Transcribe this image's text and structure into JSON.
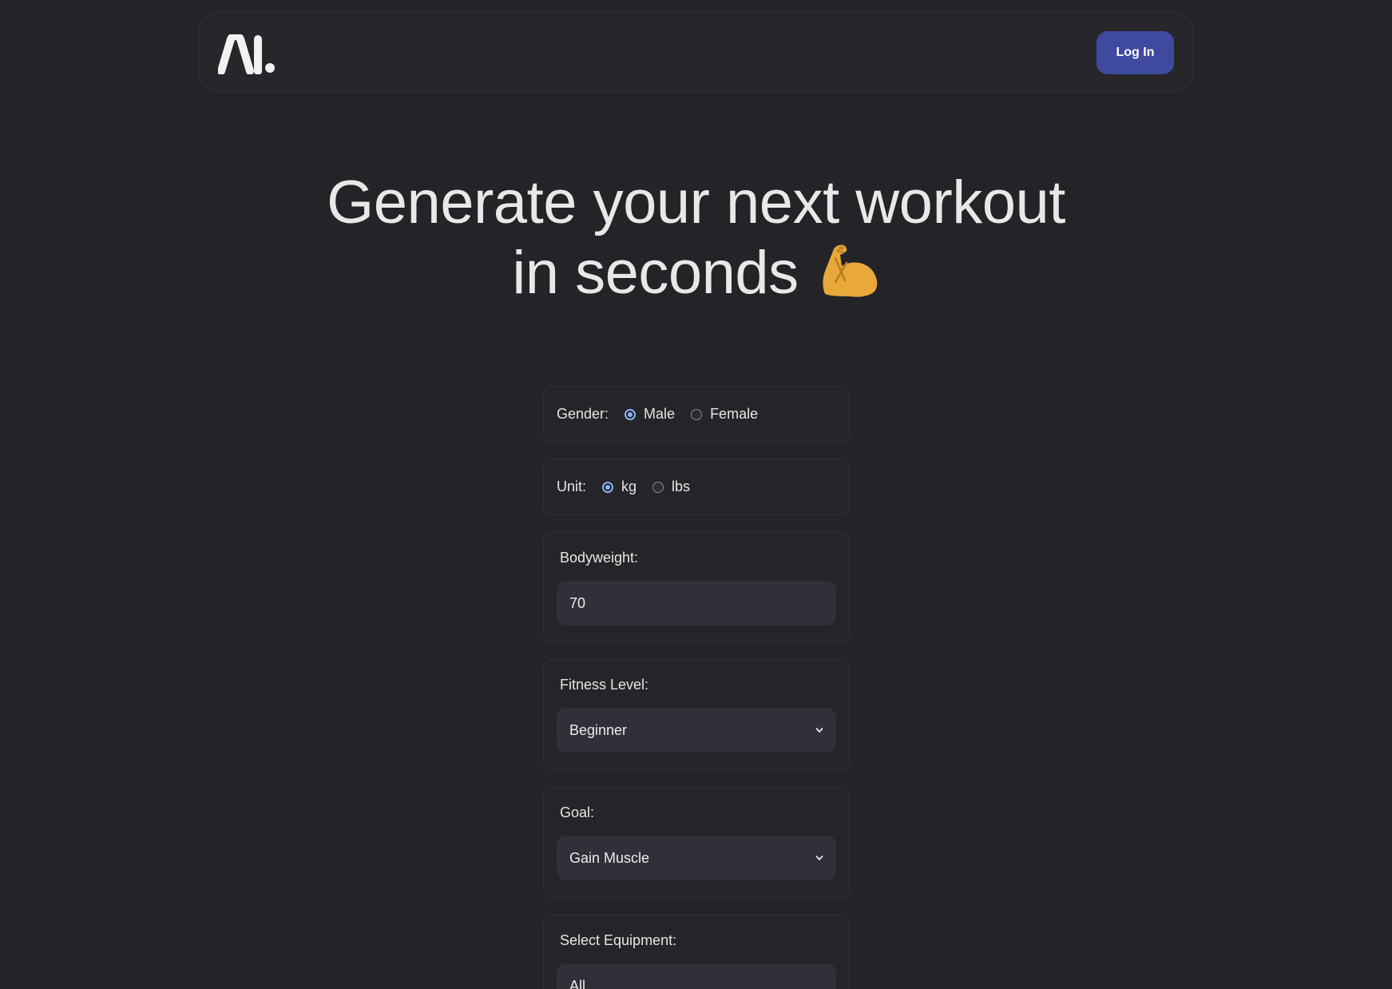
{
  "header": {
    "logo_text": "AI.",
    "login_label": "Log In"
  },
  "hero": {
    "line1": "Generate your next workout",
    "line2": "in seconds",
    "emoji_icon": "flexed-biceps-icon"
  },
  "form": {
    "gender": {
      "label": "Gender:",
      "options": [
        "Male",
        "Female"
      ],
      "selected": "Male"
    },
    "unit": {
      "label": "Unit:",
      "options": [
        "kg",
        "lbs"
      ],
      "selected": "kg"
    },
    "bodyweight": {
      "label": "Bodyweight:",
      "value": "70"
    },
    "fitness_level": {
      "label": "Fitness Level:",
      "value": "Beginner"
    },
    "goal": {
      "label": "Goal:",
      "value": "Gain Muscle"
    },
    "equipment": {
      "label": "Select Equipment:",
      "value": "All"
    }
  },
  "colors": {
    "background": "#232328",
    "accent_button": "#4049a0",
    "radio_checked": "#8ab4f8",
    "emoji": "#e8a93a"
  }
}
